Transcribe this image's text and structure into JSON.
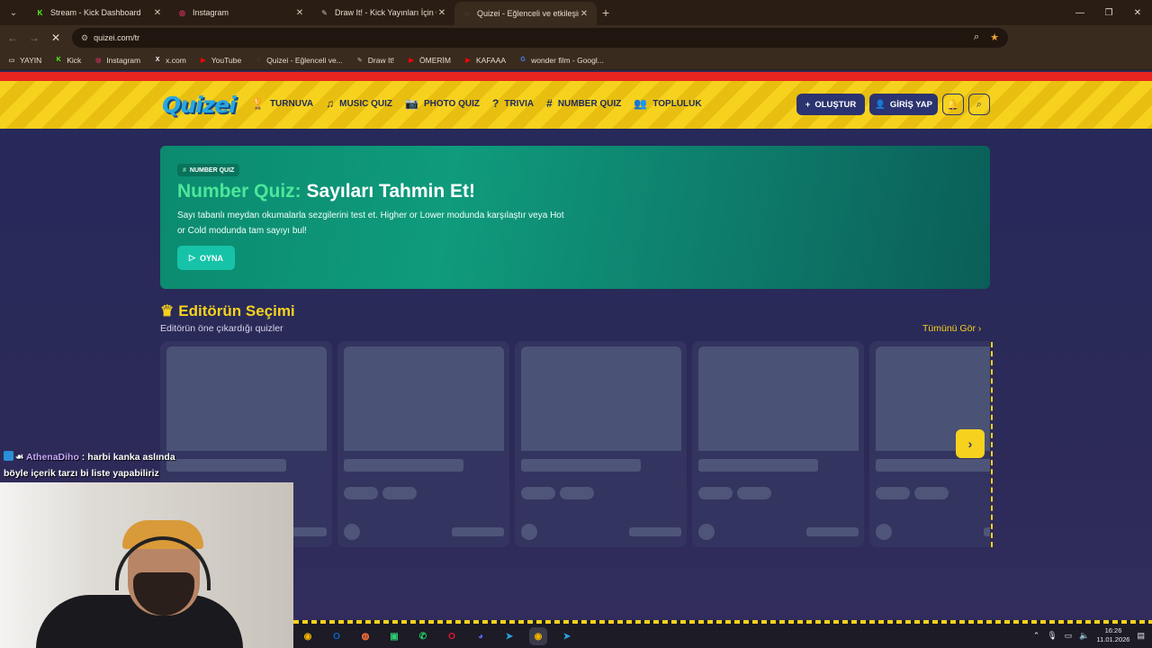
{
  "browser": {
    "tabs": [
      {
        "title": "Stream - Kick Dashboard",
        "fav_color": "#53fc18",
        "fav_glyph": "K"
      },
      {
        "title": "Instagram",
        "fav_color": "#e1306c",
        "fav_glyph": "◎"
      },
      {
        "title": "Draw It! - Kick Yayınları İçin Çiz",
        "fav_color": "#8a7c70",
        "fav_glyph": "✎"
      },
      {
        "title": "Quizei - Eğlenceli ve etkileşimli",
        "fav_color": "#8a7c70",
        "fav_glyph": "◌"
      }
    ],
    "active_tab": 3,
    "new_tab": "+",
    "url": "quizei.com/tr",
    "window_controls": [
      "—",
      "❐",
      "✕"
    ]
  },
  "bookmarks": [
    {
      "label": "YAYIN",
      "color": "#cfc3b6",
      "glyph": "▭"
    },
    {
      "label": "Kick",
      "color": "#53fc18",
      "glyph": "K"
    },
    {
      "label": "Instagram",
      "color": "#e1306c",
      "glyph": "◎"
    },
    {
      "label": "x.com",
      "color": "#ffffff",
      "glyph": "X"
    },
    {
      "label": "YouTube",
      "color": "#ff0000",
      "glyph": "▶"
    },
    {
      "label": "Quizei - Eğlenceli ve...",
      "color": "#8a7c70",
      "glyph": "◌"
    },
    {
      "label": "Draw It!",
      "color": "#8a7c70",
      "glyph": "✎"
    },
    {
      "label": "ÖMERİM",
      "color": "#ff0000",
      "glyph": "▶"
    },
    {
      "label": "KAFAAA",
      "color": "#ff0000",
      "glyph": "▶"
    },
    {
      "label": "wonder film - Googl...",
      "color": "#4285f4",
      "glyph": "G"
    }
  ],
  "site": {
    "logo": "Quizei",
    "nav": [
      {
        "label": "TURNUVA",
        "icon": "trophy-icon",
        "glyph": "🏆"
      },
      {
        "label": "MUSIC QUIZ",
        "icon": "music-icon",
        "glyph": "♫"
      },
      {
        "label": "PHOTO QUIZ",
        "icon": "camera-icon",
        "glyph": "📷"
      },
      {
        "label": "TRIVIA",
        "icon": "question-icon",
        "glyph": "?"
      },
      {
        "label": "NUMBER QUIZ",
        "icon": "hash-icon",
        "glyph": "#"
      },
      {
        "label": "TOPLULUK",
        "icon": "users-icon",
        "glyph": "👥"
      }
    ],
    "create_label": "OLUŞTUR",
    "login_label": "GİRİŞ YAP"
  },
  "hero": {
    "badge": "NUMBER QUIZ",
    "title_highlight": "Number Quiz:",
    "title_rest": " Sayıları Tahmin Et!",
    "description": "Sayı tabanlı meydan okumalarla sezgilerini test et. Higher or Lower modunda karşılaştır veya Hot or Cold modunda tam sayıyı bul!",
    "play_label": "OYNA"
  },
  "editors_pick": {
    "title": "Editörün Seçimi",
    "subtitle": "Editörün öne çıkardığı quizler",
    "see_all": "Tümünü Gör"
  },
  "chat": {
    "user": "AthenaDiho",
    "message_1": " : harbi kanka aslında",
    "message_2": "böyle içerik tarzı bi liste yapabiliriz"
  },
  "taskbar": {
    "apps": [
      {
        "name": "chrome-icon",
        "color": "#f2b400",
        "glyph": "◉"
      },
      {
        "name": "outlook-icon",
        "color": "#0a64c8",
        "glyph": "O"
      },
      {
        "name": "firefox-icon",
        "color": "#ff7139",
        "glyph": "◍"
      },
      {
        "name": "app-icon",
        "color": "#2ecc71",
        "glyph": "▣"
      },
      {
        "name": "whatsapp-icon",
        "color": "#25d366",
        "glyph": "✆"
      },
      {
        "name": "opera-icon",
        "color": "#e0162b",
        "glyph": "O"
      },
      {
        "name": "discord-icon",
        "color": "#5865f2",
        "glyph": "◕"
      },
      {
        "name": "telegram-icon",
        "color": "#2aa3e0",
        "glyph": "➤"
      },
      {
        "name": "chrome-active-icon",
        "color": "#f2b400",
        "glyph": "◉"
      },
      {
        "name": "telegram-2-icon",
        "color": "#2aa3e0",
        "glyph": "➤"
      }
    ],
    "time": "16:26",
    "date": "11.01.2026"
  }
}
